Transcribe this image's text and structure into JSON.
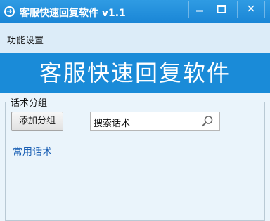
{
  "window": {
    "title": "客服快速回复软件 v1.1",
    "icon": "arrow-circle-icon",
    "controls": {
      "minimize": "minimize-icon",
      "maximize": "maximize-icon",
      "close": "close-icon"
    }
  },
  "menu": {
    "items": [
      {
        "label": "功能设置"
      }
    ]
  },
  "banner": {
    "text": "客服快速回复软件"
  },
  "group": {
    "legend": "话术分组",
    "add_button": "添加分组",
    "search": {
      "value": "搜索话术",
      "icon": "search-icon"
    },
    "link": "常用话术"
  },
  "colors": {
    "titlebar": "#1a86d6",
    "banner": "#1a8bd8",
    "background": "#eaf4fb",
    "link": "#1a5fb4"
  }
}
